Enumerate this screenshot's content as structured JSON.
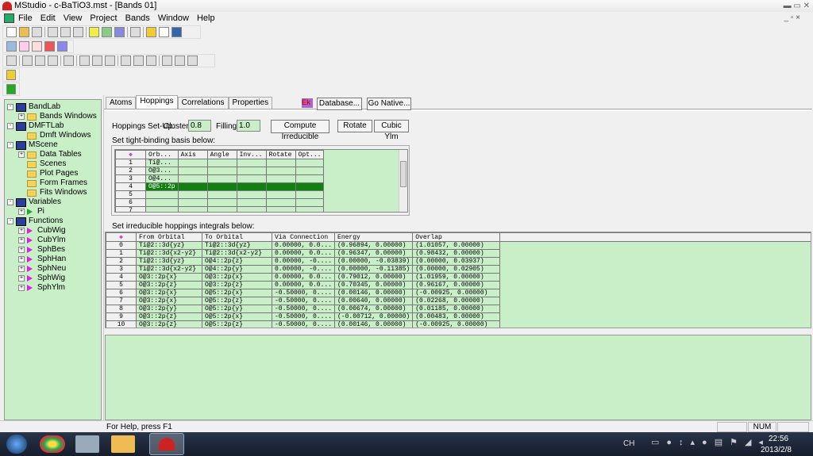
{
  "window": {
    "title": "MStudio - c-BaTiO3.mst - [Bands 01]"
  },
  "menu": [
    "File",
    "Edit",
    "View",
    "Project",
    "Bands",
    "Window",
    "Help"
  ],
  "tree": [
    {
      "label": "BandLab",
      "kind": "app",
      "level": 0,
      "exp": "-"
    },
    {
      "label": "Bands Windows",
      "kind": "folder",
      "level": 1,
      "exp": "+"
    },
    {
      "label": "DMFTLab",
      "kind": "app",
      "level": 0,
      "exp": "-"
    },
    {
      "label": "Dmft Windows",
      "kind": "folder",
      "level": 1,
      "exp": ""
    },
    {
      "label": "MScene",
      "kind": "app",
      "level": 0,
      "exp": "-"
    },
    {
      "label": "Data Tables",
      "kind": "folder",
      "level": 1,
      "exp": "+"
    },
    {
      "label": "Scenes",
      "kind": "folder",
      "level": 1,
      "exp": ""
    },
    {
      "label": "Plot Pages",
      "kind": "folder",
      "level": 1,
      "exp": ""
    },
    {
      "label": "Form Frames",
      "kind": "folder",
      "level": 1,
      "exp": ""
    },
    {
      "label": "Fits Windows",
      "kind": "folder",
      "level": 1,
      "exp": ""
    },
    {
      "label": "Variables",
      "kind": "app",
      "level": 0,
      "exp": "-"
    },
    {
      "label": "Pi",
      "kind": "var",
      "level": 1,
      "exp": "+"
    },
    {
      "label": "Functions",
      "kind": "app",
      "level": 0,
      "exp": "-"
    },
    {
      "label": "CubWig",
      "kind": "fn",
      "level": 1,
      "exp": "+"
    },
    {
      "label": "CubYlm",
      "kind": "fn",
      "level": 1,
      "exp": "+"
    },
    {
      "label": "SphBes",
      "kind": "fn",
      "level": 1,
      "exp": "+"
    },
    {
      "label": "SphHan",
      "kind": "fn",
      "level": 1,
      "exp": "+"
    },
    {
      "label": "SphNeu",
      "kind": "fn",
      "level": 1,
      "exp": "+"
    },
    {
      "label": "SphWig",
      "kind": "fn",
      "level": 1,
      "exp": "+"
    },
    {
      "label": "SphYlm",
      "kind": "fn",
      "level": 1,
      "exp": "+"
    }
  ],
  "tabs": [
    "Atoms",
    "Hoppings",
    "Correlations",
    "Properties"
  ],
  "buttons": {
    "database": "Database...",
    "go_native": "Go Native...",
    "compute": "Compute Irreducible",
    "rotate": "Rotate",
    "cubic": "Cubic Ylm"
  },
  "setup": {
    "label": "Hoppings Set-Up:",
    "cluster_label": "Cluster:",
    "cluster": "0.8",
    "filling_label": "Filling:",
    "filling": "1.0"
  },
  "basis": {
    "label": "Set tight-binding basis below:",
    "headers": [
      "Orb...",
      "Axis",
      "Angle",
      "Inv...",
      "Rotate",
      "Opt..."
    ],
    "rows": [
      [
        "1",
        "Ti@..."
      ],
      [
        "2",
        "O@3..."
      ],
      [
        "3",
        "O@4..."
      ],
      [
        "4",
        "O@5::2p"
      ],
      [
        "5",
        ""
      ],
      [
        "6",
        ""
      ],
      [
        "7",
        ""
      ]
    ],
    "selected": "4"
  },
  "hop": {
    "label": "Set irreducible hoppings integrals below:",
    "headers": [
      "From Orbital",
      "To Orbital",
      "Via Connection",
      "Energy",
      "Overlap"
    ],
    "rows": [
      [
        "0",
        "Ti@2::3d{yz}",
        "Ti@2::3d{yz}",
        "0.00000, 0.0...",
        "(0.96894, 0.00000)",
        "(1.01057, 0.00000)"
      ],
      [
        "1",
        "Ti@2::3d{x2-y2}",
        "Ti@2::3d{x2-y2}",
        "0.00000, 0.0...",
        "(0.96347, 0.00000)",
        "(0.98432, 0.00000)"
      ],
      [
        "2",
        "Ti@2::3d{yz}",
        "O@4::2p{z}",
        "0.00000, -0....",
        "(0.00000, -0.03839)",
        "(0.00000, 0.03937)"
      ],
      [
        "3",
        "Ti@2::3d{x2-y2}",
        "O@4::2p{y}",
        "0.00000, -0....",
        "(0.00000, -0.11385)",
        "(0.00000, 0.02905)"
      ],
      [
        "4",
        "O@3::2p{x}",
        "O@3::2p{x}",
        "0.00000, 0.0...",
        "(0.79012, 0.00000)",
        "(1.01959, 0.00000)"
      ],
      [
        "5",
        "O@3::2p{z}",
        "O@3::2p{z}",
        "0.00000, 0.0...",
        "(0.70345, 0.00000)",
        "(0.96167, 0.00000)"
      ],
      [
        "6",
        "O@3::2p{x}",
        "O@5::2p{x}",
        "-0.50000, 0....",
        "(0.00146, 0.00000)",
        "(-0.00925, 0.00000)"
      ],
      [
        "7",
        "O@3::2p{x}",
        "O@5::2p{z}",
        "-0.50000, 0....",
        "(0.00640, 0.00000)",
        "(0.02268, 0.00000)"
      ],
      [
        "8",
        "O@3::2p{y}",
        "O@5::2p{y}",
        "-0.50000, 0....",
        "(0.00674, 0.00000)",
        "(0.01185, 0.00000)"
      ],
      [
        "9",
        "O@3::2p{z}",
        "O@5::2p{x}",
        "-0.50000, 0....",
        "(-0.00712, 0.00000)",
        "(0.00483, 0.00000)"
      ],
      [
        "10",
        "O@3::2p{z}",
        "O@5::2p{z}",
        "-0.50000, 0....",
        "(0.00146, 0.00000)",
        "(-0.00925, 0.00000)"
      ]
    ]
  },
  "status": {
    "help": "For Help, press F1",
    "num": "NUM"
  },
  "taskbar": {
    "lang": "CH",
    "time": "22:56",
    "date": "2013/2/8"
  }
}
